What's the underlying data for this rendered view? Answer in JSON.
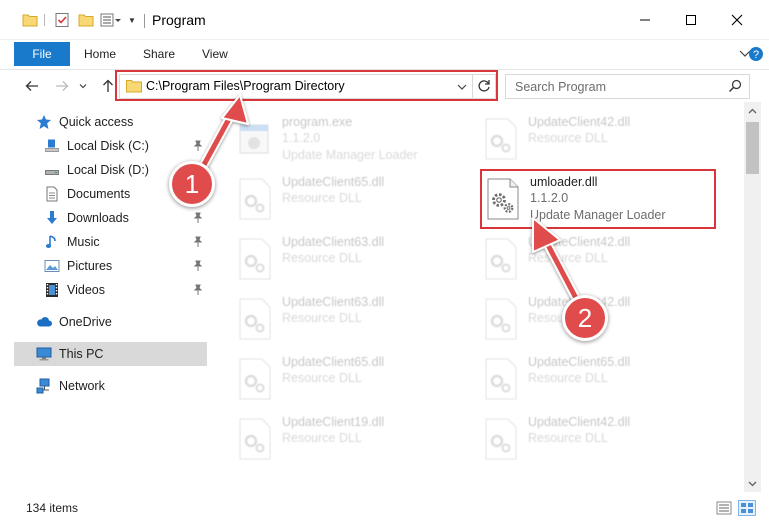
{
  "window": {
    "title": "Program",
    "controls": [
      "minimize",
      "maximize",
      "close"
    ]
  },
  "quick_access_toolbar": {
    "icons": [
      "folder-icon",
      "properties-icon",
      "new-folder-icon",
      "customize-icon"
    ]
  },
  "ribbon": {
    "tabs": [
      {
        "label": "File",
        "active": true
      },
      {
        "label": "Home"
      },
      {
        "label": "Share"
      },
      {
        "label": "View"
      }
    ]
  },
  "address_bar": {
    "path": "C:\\Program Files\\Program Directory"
  },
  "search": {
    "placeholder": "Search Program"
  },
  "navigation": {
    "items": [
      {
        "label": "Quick access",
        "icon": "star-icon",
        "level": 1
      },
      {
        "label": "Local Disk (C:)",
        "icon": "drive-icon",
        "level": 2,
        "pinned": true
      },
      {
        "label": "Local Disk (D:)",
        "icon": "drive-icon",
        "level": 2,
        "pinned": false
      },
      {
        "label": "Documents",
        "icon": "documents-icon",
        "level": 2,
        "pinned": true
      },
      {
        "label": "Downloads",
        "icon": "downloads-icon",
        "level": 2,
        "pinned": true
      },
      {
        "label": "Music",
        "icon": "music-icon",
        "level": 2,
        "pinned": true
      },
      {
        "label": "Pictures",
        "icon": "pictures-icon",
        "level": 2,
        "pinned": true
      },
      {
        "label": "Videos",
        "icon": "videos-icon",
        "level": 2,
        "pinned": true
      },
      {
        "label": "OneDrive",
        "icon": "cloud-icon",
        "level": 1
      },
      {
        "label": "This PC",
        "icon": "computer-icon",
        "level": 1,
        "selected": true
      },
      {
        "label": "Network",
        "icon": "network-icon",
        "level": 1
      }
    ]
  },
  "files": [
    {
      "name": "program.exe",
      "version": "1.1.2.0",
      "description": "Update Manager Loader",
      "dimmed": true
    },
    {
      "name": "UpdateClient42.dll",
      "version": "Resource DLL",
      "dimmed": true
    },
    {
      "name": "UpdateClient65.dll",
      "version": "Resource DLL",
      "dimmed": true
    },
    {
      "name": "umloader.dll",
      "version": "1.1.2.0",
      "description": "Update Manager Loader",
      "dimmed": false,
      "highlighted": true
    },
    {
      "name": "UpdateClient63.dll",
      "version": "Resource DLL",
      "dimmed": true
    },
    {
      "name": "UpdateClient42.dll",
      "version": "Resource DLL",
      "dimmed": true
    },
    {
      "name": "UpdateClient63.dll",
      "version": "Resource DLL",
      "dimmed": true
    },
    {
      "name": "UpdateClient42.dll",
      "version": "Resource DLL",
      "dimmed": true
    },
    {
      "name": "UpdateClient65.dll",
      "version": "Resource DLL",
      "dimmed": true
    },
    {
      "name": "UpdateClient65.dll",
      "version": "Resource DLL",
      "dimmed": true
    },
    {
      "name": "UpdateClient19.dll",
      "version": "Resource DLL",
      "dimmed": true
    },
    {
      "name": "UpdateClient42.dll",
      "version": "Resource DLL",
      "dimmed": true
    }
  ],
  "status_bar": {
    "item_count": "134 items"
  },
  "callouts": [
    {
      "number": "1"
    },
    {
      "number": "2"
    }
  ],
  "colors": {
    "accent": "#1979ca",
    "highlight": "#d9363b",
    "callout": "#e04b4b",
    "selection": "#d9d9d9"
  }
}
